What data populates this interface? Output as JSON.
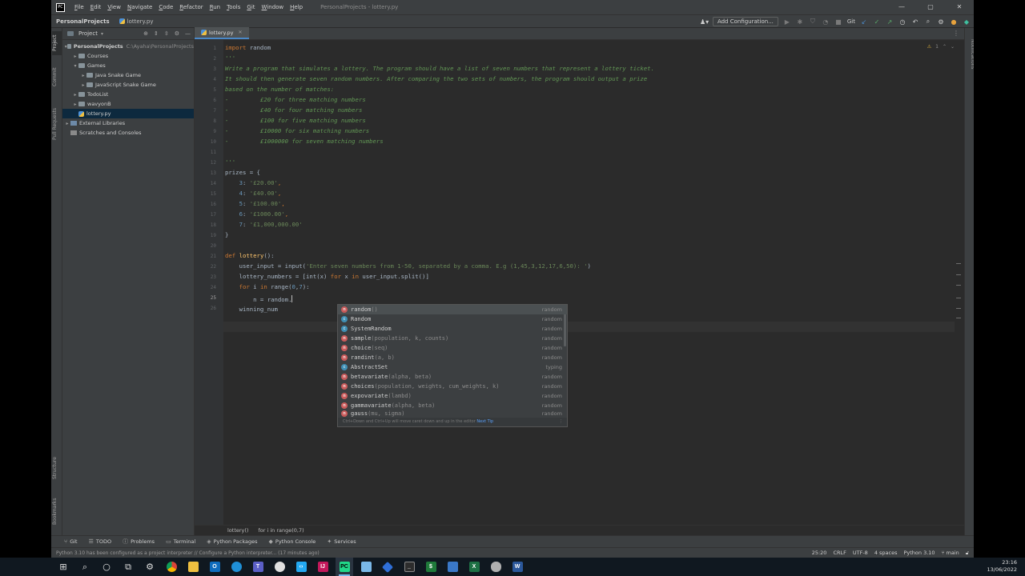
{
  "window": {
    "menu": [
      "File",
      "Edit",
      "View",
      "Navigate",
      "Code",
      "Refactor",
      "Run",
      "Tools",
      "Git",
      "Window",
      "Help"
    ],
    "title": "PersonalProjects - lottery.py",
    "controls": [
      "—",
      "▢",
      "✕"
    ]
  },
  "nav": {
    "project": "PersonalProjects",
    "file": "lottery.py",
    "add_configuration": "Add Configuration...",
    "git_label": "Git"
  },
  "stripes": {
    "left": [
      "Project",
      "Commit",
      "Pull Requests",
      "Structure",
      "Bookmarks"
    ],
    "right": [
      "Notifications"
    ]
  },
  "project_panel": {
    "title": "Project",
    "tree": [
      {
        "label": "PersonalProjects",
        "path": "C:\\Ayaha\\PersonalProjects",
        "bold": true
      },
      {
        "label": "Courses"
      },
      {
        "label": "Games"
      },
      {
        "label": "Java Snake Game"
      },
      {
        "label": "JavaScript Snake Game"
      },
      {
        "label": "TodoList"
      },
      {
        "label": "wavyonB"
      },
      {
        "label": "lottery.py"
      },
      {
        "label": "External Libraries"
      },
      {
        "label": "Scratches and Consoles"
      }
    ]
  },
  "editor": {
    "tab_label": "lottery.py",
    "warning_count": "1",
    "lines": [
      "1",
      "2",
      "3",
      "4",
      "5",
      "6",
      "7",
      "8",
      "9",
      "10",
      "11",
      "12",
      "13",
      "14",
      "15",
      "16",
      "17",
      "18",
      "19",
      "20",
      "21",
      "22",
      "23",
      "24",
      "25",
      "26"
    ],
    "code": {
      "l1_kw": "import",
      "l1_rest": " random",
      "l2": "'''",
      "l3": "Write a program that simulates a lottery. The program should have a list of seven numbers that represent a lottery ticket.",
      "l4": "It should then generate seven random numbers. After comparing the two sets of numbers, the program should output a prize",
      "l5": "based on the number of matches:",
      "l6": "-         £20 for three matching numbers",
      "l7": "-         £40 for four matching numbers",
      "l8": "-         £100 for five matching numbers",
      "l9": "-         £10000 for six matching numbers",
      "l10": "-         £1000000 for seven matching numbers",
      "l12": "'''",
      "l13": "prizes = {",
      "l14_k": "    3",
      "l14_v": "'£20.00'",
      "l15_k": "    4",
      "l15_v": "'£40.00'",
      "l16_k": "    5",
      "l16_v": "'£100.00'",
      "l17_k": "    6",
      "l17_v": "'£1000.00'",
      "l18_k": "    7",
      "l18_v": "'£1,000,000.00'",
      "l19": "}",
      "l21_kw": "def",
      "l21_fn": "lottery",
      "l21_rest": "():",
      "l22_a": "    user_input = input(",
      "l22_s": "'Enter seven numbers from 1-50, separated by a comma. E.g (1,45,3,12,17,6,50): '",
      "l22_b": ")",
      "l23_a": "    lottery_numbers = [int(x) ",
      "l23_kw1": "for",
      "l23_b": " x ",
      "l23_kw2": "in",
      "l23_c": " user_input.split()]",
      "l24_kw1": "for",
      "l24_a": " i ",
      "l24_kw2": "in",
      "l24_b": " range(",
      "l24_n1": "0",
      "l24_c": ",",
      "l24_n2": "7",
      "l24_d": "):",
      "l25": "        n = random.",
      "l26": "    winning_num"
    }
  },
  "completion": {
    "items": [
      {
        "name": "random",
        "args": "()",
        "module": "random",
        "kind": "m"
      },
      {
        "name": "Random",
        "args": "",
        "module": "random",
        "kind": "c"
      },
      {
        "name": "SystemRandom",
        "args": "",
        "module": "random",
        "kind": "c"
      },
      {
        "name": "sample",
        "args": "(population, k, counts)",
        "module": "random",
        "kind": "m"
      },
      {
        "name": "choice",
        "args": "(seq)",
        "module": "random",
        "kind": "m"
      },
      {
        "name": "randint",
        "args": "(a, b)",
        "module": "random",
        "kind": "m"
      },
      {
        "name": "AbstractSet",
        "args": "",
        "module": "typing",
        "kind": "c"
      },
      {
        "name": "betavariate",
        "args": "(alpha, beta)",
        "module": "random",
        "kind": "m"
      },
      {
        "name": "choices",
        "args": "(population, weights, cum_weights, k)",
        "module": "random",
        "kind": "m"
      },
      {
        "name": "expovariate",
        "args": "(lambd)",
        "module": "random",
        "kind": "m"
      },
      {
        "name": "gammavariate",
        "args": "(alpha, beta)",
        "module": "random",
        "kind": "m"
      },
      {
        "name": "gauss",
        "args": "(mu, sigma)",
        "module": "random",
        "kind": "m"
      }
    ],
    "hint": "Ctrl+Down and Ctrl+Up will move caret down and up in the editor",
    "hint_link": "Next Tip"
  },
  "breadcrumb": [
    "lottery()",
    "for i in range(0,7)"
  ],
  "tool_windows": [
    "Git",
    "TODO",
    "Problems",
    "Terminal",
    "Python Packages",
    "Python Console",
    "Services"
  ],
  "status": {
    "message": "Python 3.10 has been configured as a project interpreter // Configure a Python interpreter... (17 minutes ago)",
    "position": "25:20",
    "line_sep": "CRLF",
    "encoding": "UTF-8",
    "indent": "4 spaces",
    "interpreter": "Python 3.10",
    "branch": "main"
  },
  "taskbar": {
    "time": "23:16",
    "date": "13/06/2022"
  }
}
